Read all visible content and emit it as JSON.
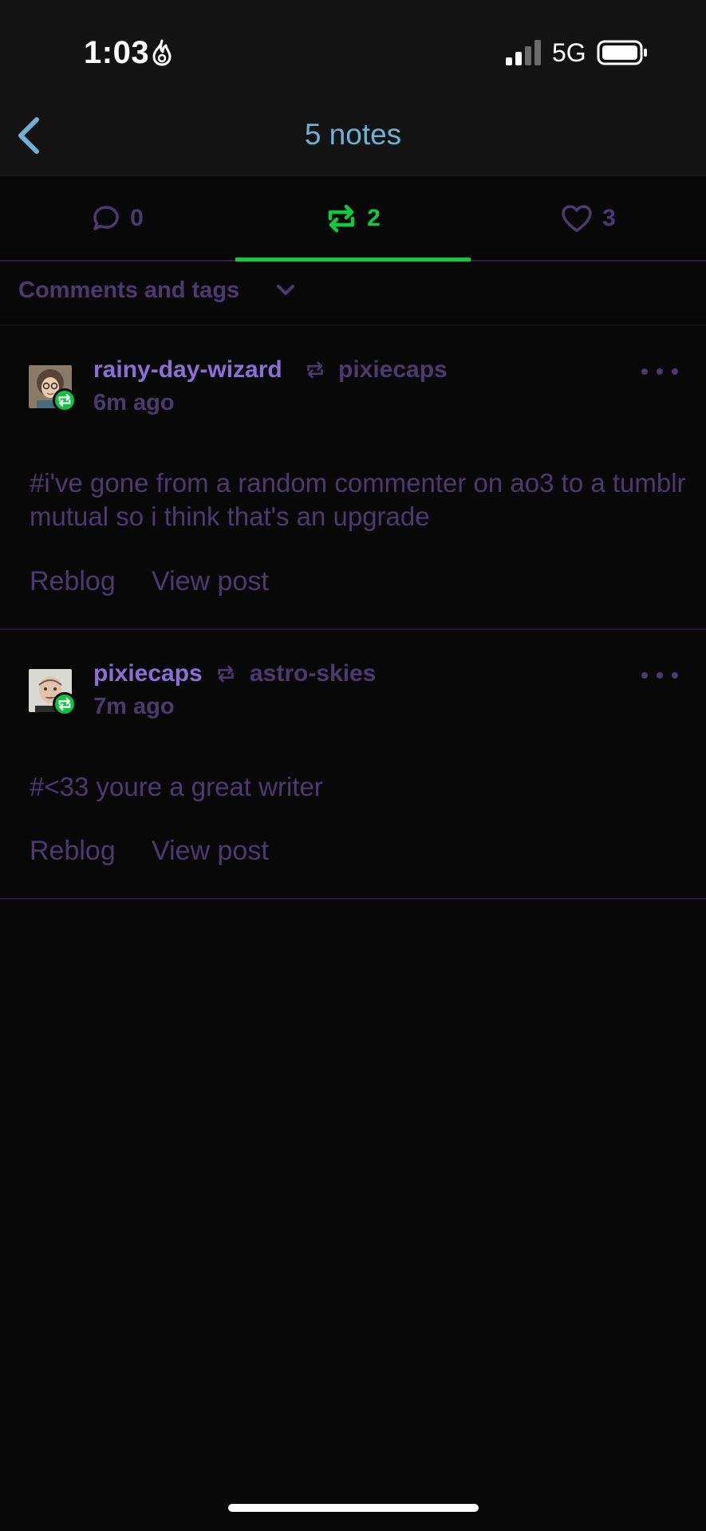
{
  "status_bar": {
    "time": "1:03",
    "network": "5G"
  },
  "header": {
    "title": "5 notes"
  },
  "tabs": [
    {
      "name": "comments",
      "count": "0"
    },
    {
      "name": "reblogs",
      "count": "2"
    },
    {
      "name": "likes",
      "count": "3"
    }
  ],
  "filter": {
    "label": "Comments and tags"
  },
  "notes": [
    {
      "username": "rainy-day-wizard",
      "reblogged_from": "pixiecaps",
      "time": "6m ago",
      "tags": "#i've gone from a random commenter on ao3 to a tumblr mutual so i think that's an upgrade",
      "actions": {
        "reblog": "Reblog",
        "view_post": "View post"
      }
    },
    {
      "username": "pixiecaps",
      "reblogged_from": "astro-skies",
      "time": "7m ago",
      "tags": "#<33 youre a great writer",
      "actions": {
        "reblog": "Reblog",
        "view_post": "View post"
      }
    }
  ],
  "colors": {
    "background": "#080809",
    "accent_green": "#0fcc3f",
    "accent_purple": "#8b6fd6",
    "muted_purple": "#4b3a70",
    "title_blue": "#6fb1d6"
  }
}
